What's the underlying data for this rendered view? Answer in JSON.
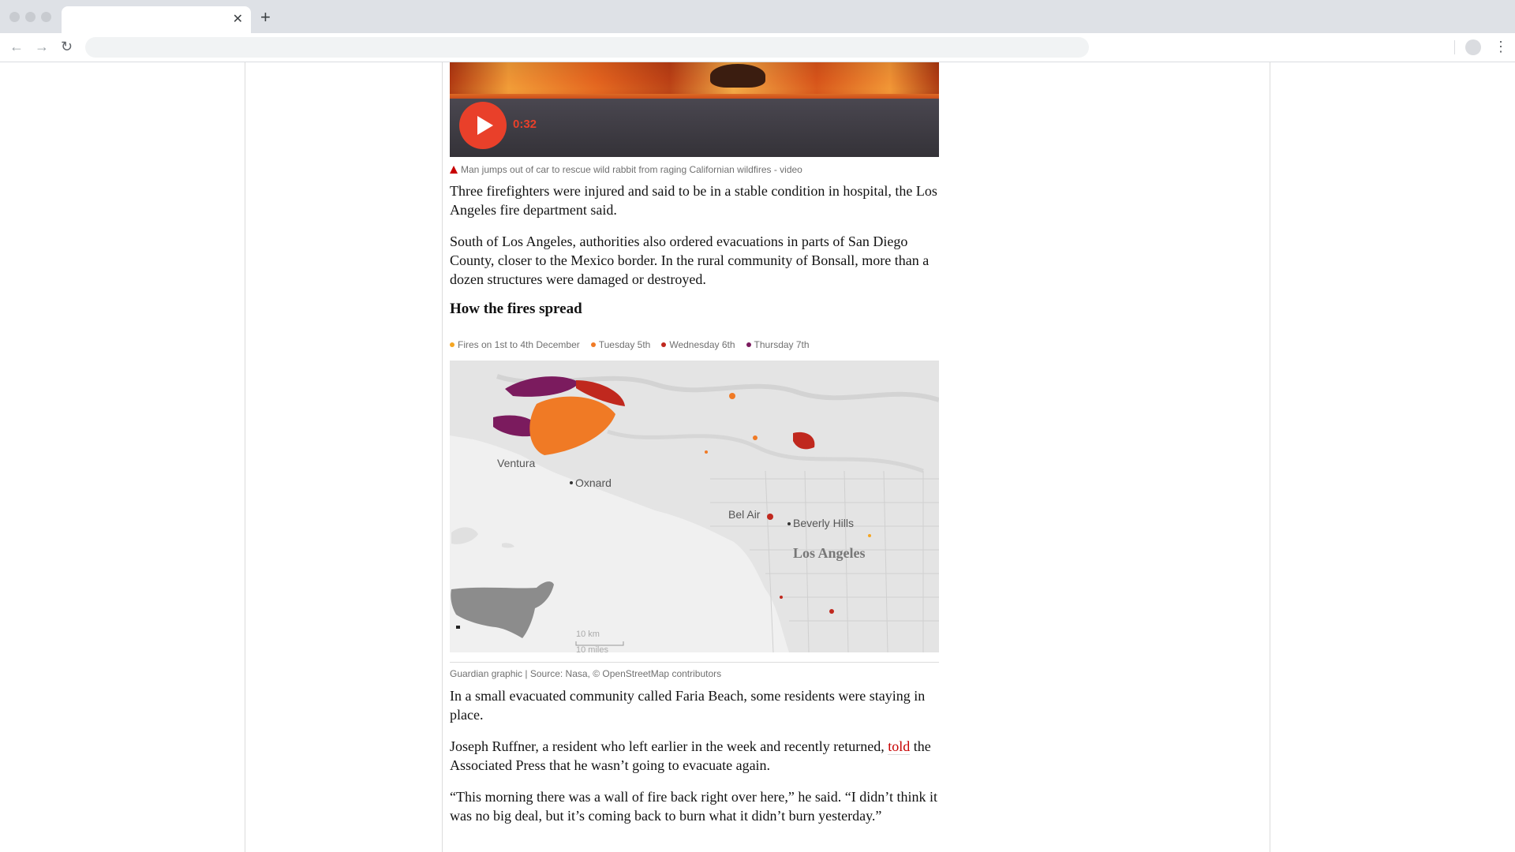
{
  "browser": {
    "tab_close_glyph": "✕",
    "new_tab_glyph": "+",
    "back_glyph": "←",
    "forward_glyph": "→",
    "reload_glyph": "↻",
    "menu_glyph": "⋮"
  },
  "video": {
    "duration": "0:32",
    "caption": "Man jumps out of car to rescue wild rabbit from raging Californian wildfires - video"
  },
  "article": {
    "p1": "Three firefighters were injured and said to be in a stable condition in hospital, the Los Angeles fire department said.",
    "p2": "South of Los Angeles, authorities also ordered evacuations in parts of San Diego County, closer to the Mexico border. In the rural community of Bonsall, more than a dozen structures were damaged or destroyed.",
    "heading": "How the fires spread",
    "p3": "In a small evacuated community called Faria Beach, some residents were staying in place.",
    "p4_before": "Joseph Ruffner, a resident who left earlier in the week and recently returned,",
    "p4_link": "told",
    "p4_after": "the Associated Press that he wasn’t going to evacuate again.",
    "p5": "“This morning there was a wall of fire back right over here,” he said. “I didn’t think it was no big deal, but it’s coming back to burn what it didn’t burn yesterday.”"
  },
  "map": {
    "legend": [
      {
        "label": "Fires on 1st to 4th December",
        "color": "#f5a623"
      },
      {
        "label": "Tuesday 5th",
        "color": "#f07a25"
      },
      {
        "label": "Wednesday 6th",
        "color": "#c0281e"
      },
      {
        "label": "Thursday 7th",
        "color": "#7b1b5e"
      }
    ],
    "places": {
      "ventura": "Ventura",
      "oxnard": "Oxnard",
      "bel_air": "Bel Air",
      "beverly_hills": "Beverly Hills",
      "los_angeles": "Los Angeles"
    },
    "scale_km": "10 km",
    "scale_miles": "10 miles",
    "credit": "Guardian graphic | Source: Nasa, © OpenStreetMap contributors"
  }
}
